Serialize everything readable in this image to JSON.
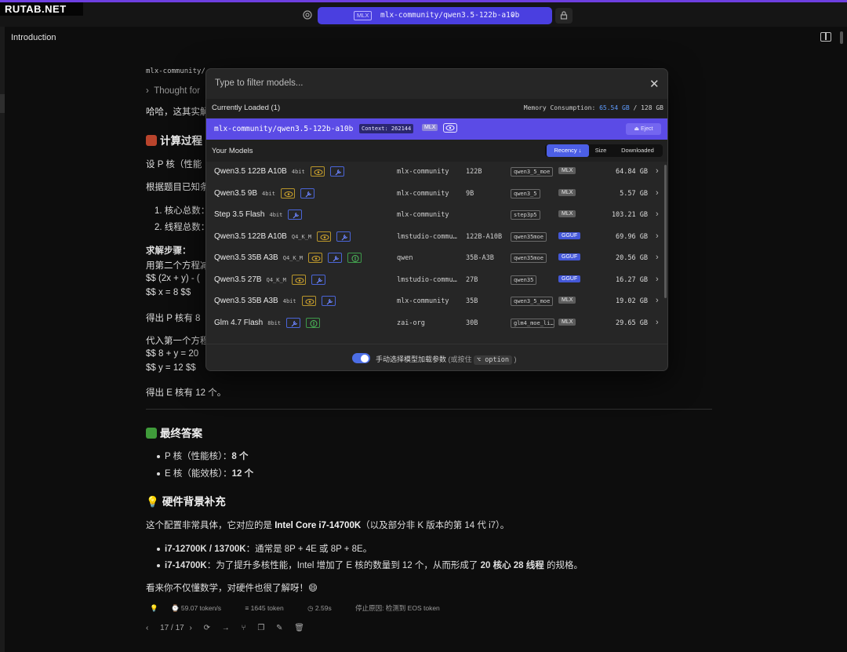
{
  "watermark": "RUTAB.NET",
  "topbar": {
    "model_format": "MLX",
    "model_name": "mlx-community/qwen3.5-122b-a10b",
    "chevron": "⌄"
  },
  "header": {
    "title": "Introduction"
  },
  "chat": {
    "model_line": "mlx-community/",
    "thought_label": "Thought for",
    "p_intro": "哈哈，这其实解",
    "h_calc": "计算过程",
    "p_let": "设 P 核（性能",
    "p_known": "根据题目已知条",
    "li1": "1. 核心总数：",
    "li2": "2. 线程总数：",
    "steps_title": "求解步骤：",
    "steps_1": "用第二个方程减",
    "steps_2": "$$ (2x + y) - (",
    "steps_3": "$$ x = 8 $$",
    "p_result1": "得出 P 核有 8",
    "sub1": "代入第一个方程",
    "sub2": "$$ 8 + y = 20",
    "sub3": "$$ y = 12 $$",
    "p_result2": "得出 E 核有 12 个。",
    "h_answer": "最终答案",
    "ans1_k": "P 核（性能核）：",
    "ans1_v": "8 个",
    "ans2_k": "E 核（能效核）：",
    "ans2_v": "12 个",
    "h_bg": "硬件背景补充",
    "bg_p1": "这个配置非常具体，它对应的是 ",
    "bg_p1_b": "Intel Core i7-14700K",
    "bg_p1_end": "（以及部分非 K 版本的第 14 代 i7）。",
    "bg_li1_b": "i7-12700K / 13700K",
    "bg_li1": "：通常是 8P + 4E 或 8P + 8E。",
    "bg_li2_b": "i7-14700K",
    "bg_li2": "：为了提升多核性能，Intel 增加了 E 核的数量到 12 个，从而形成了 ",
    "bg_li2_b2": "20 核心 28 线程",
    "bg_li2_end": " 的规格。",
    "closing": "看来你不仅懂数学，对硬件也很了解呀！😄"
  },
  "stats": {
    "speed": "59.07 token/s",
    "tokens": "1645 token",
    "time": "2.59s",
    "stop": "停止原因: 检测到 EOS token"
  },
  "pager": {
    "label": "17 / 17"
  },
  "modal": {
    "filter_placeholder": "Type to filter models...",
    "close": "✕",
    "loaded_title": "Currently Loaded (1)",
    "memory_label": "Memory Consumption:",
    "memory_used": "65.54 GB",
    "memory_total": "/ 128 GB",
    "loaded_name": "mlx-community/qwen3.5-122b-a10b",
    "loaded_context": "Context: 262144",
    "loaded_format": "MLX",
    "eject_label": "⏏ Eject",
    "models_title": "Your Models",
    "sort": {
      "recency": "Recency ↓",
      "size": "Size",
      "downloaded": "Downloaded"
    },
    "footer_text": "手动选择模型加载参数",
    "footer_hint_open": "(或按住",
    "footer_key": "⌥ option",
    "footer_hint_close": ")"
  },
  "models": [
    {
      "name": "Qwen3.5 122B A10B",
      "quant": "4bit",
      "caps": [
        "vision",
        "tool"
      ],
      "publisher": "mlx-community",
      "params": "122B",
      "arch": "qwen3_5_moe",
      "format": "MLX",
      "size": "64.84 GB"
    },
    {
      "name": "Qwen3.5 9B",
      "quant": "4bit",
      "caps": [
        "vision",
        "tool"
      ],
      "publisher": "mlx-community",
      "params": "9B",
      "arch": "qwen3_5",
      "format": "MLX",
      "size": "5.57 GB"
    },
    {
      "name": "Step 3.5 Flash",
      "quant": "4bit",
      "caps": [
        "tool"
      ],
      "publisher": "mlx-community",
      "params": "",
      "arch": "step3p5",
      "format": "MLX",
      "size": "103.21 GB"
    },
    {
      "name": "Qwen3.5 122B A10B",
      "quant": "Q4_K_M",
      "caps": [
        "vision",
        "tool"
      ],
      "publisher": "lmstudio-commu…",
      "params": "122B-A10B",
      "arch": "qwen35moe",
      "format": "GGUF",
      "size": "69.96 GB"
    },
    {
      "name": "Qwen3.5 35B A3B",
      "quant": "Q4_K_M",
      "caps": [
        "vision",
        "tool",
        "reason"
      ],
      "publisher": "qwen",
      "params": "35B-A3B",
      "arch": "qwen35moe",
      "format": "GGUF",
      "size": "20.56 GB"
    },
    {
      "name": "Qwen3.5 27B",
      "quant": "Q4_K_M",
      "caps": [
        "vision",
        "tool"
      ],
      "publisher": "lmstudio-commu…",
      "params": "27B",
      "arch": "qwen35",
      "format": "GGUF",
      "size": "16.27 GB"
    },
    {
      "name": "Qwen3.5 35B A3B",
      "quant": "4bit",
      "caps": [
        "vision",
        "tool"
      ],
      "publisher": "mlx-community",
      "params": "35B",
      "arch": "qwen3_5_moe",
      "format": "MLX",
      "size": "19.02 GB"
    },
    {
      "name": "Glm 4.7 Flash",
      "quant": "8bit",
      "caps": [
        "tool",
        "reason"
      ],
      "publisher": "zai-org",
      "params": "30B",
      "arch": "glm4_moe_li…",
      "format": "MLX",
      "size": "29.65 GB"
    }
  ],
  "colors": {
    "accent": "#5b4be6",
    "topbar_pill": "#4a3fe0",
    "gguf": "#4458d8",
    "memory": "#5f9cff"
  }
}
